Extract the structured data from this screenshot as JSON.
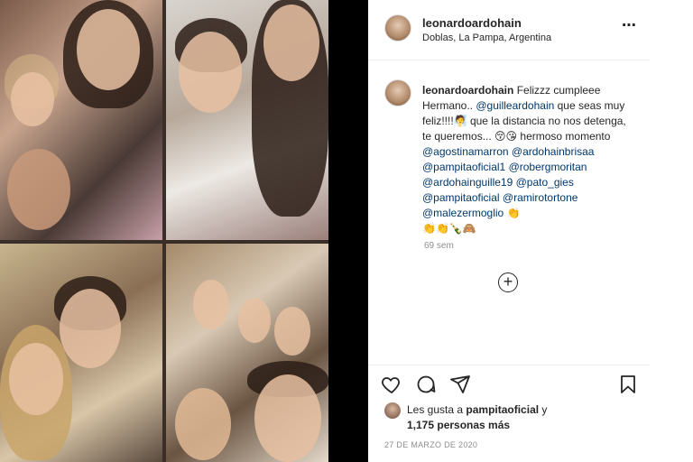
{
  "post": {
    "username": "leonardoardohain",
    "location": "Doblas, La Pampa, Argentina",
    "more_icon": "⋯"
  },
  "caption": {
    "username": "leonardoardohain",
    "text_1": "Felizzz cumpleee Hermano..",
    "mention_1": "@guilleardohain",
    "text_2": "que seas muy feliz!!!!🧖 que la distancia no nos detenga, te queremos... 😚😘 hermoso momento",
    "mention_2": "@agostinamarron",
    "mention_3": "@ardohainbrisaa",
    "mention_4": "@pampitaoficial1",
    "mention_5": "@robergmoritan",
    "mention_6": "@ardohainguille19",
    "mention_7": "@pato_gies",
    "mention_8": "@pampitaoficial",
    "mention_9": "@ramirotortone",
    "mention_10": "@malezermoglio",
    "emojis_end": "👏",
    "emojis_line": "👏👏🍾🙈",
    "time": "69 sem"
  },
  "actions": {
    "like_icon": "heart-icon",
    "comment_icon": "comment-icon",
    "share_icon": "send-icon",
    "save_icon": "bookmark-icon"
  },
  "likes": {
    "prefix": "Les gusta a",
    "user": "pampitaoficial",
    "connector": "y",
    "count": "1,175 personas más"
  },
  "date": "27 DE MARZO DE 2020",
  "colors": {
    "mention": "#00376b",
    "text": "#262626",
    "muted": "#8e8e8e"
  }
}
